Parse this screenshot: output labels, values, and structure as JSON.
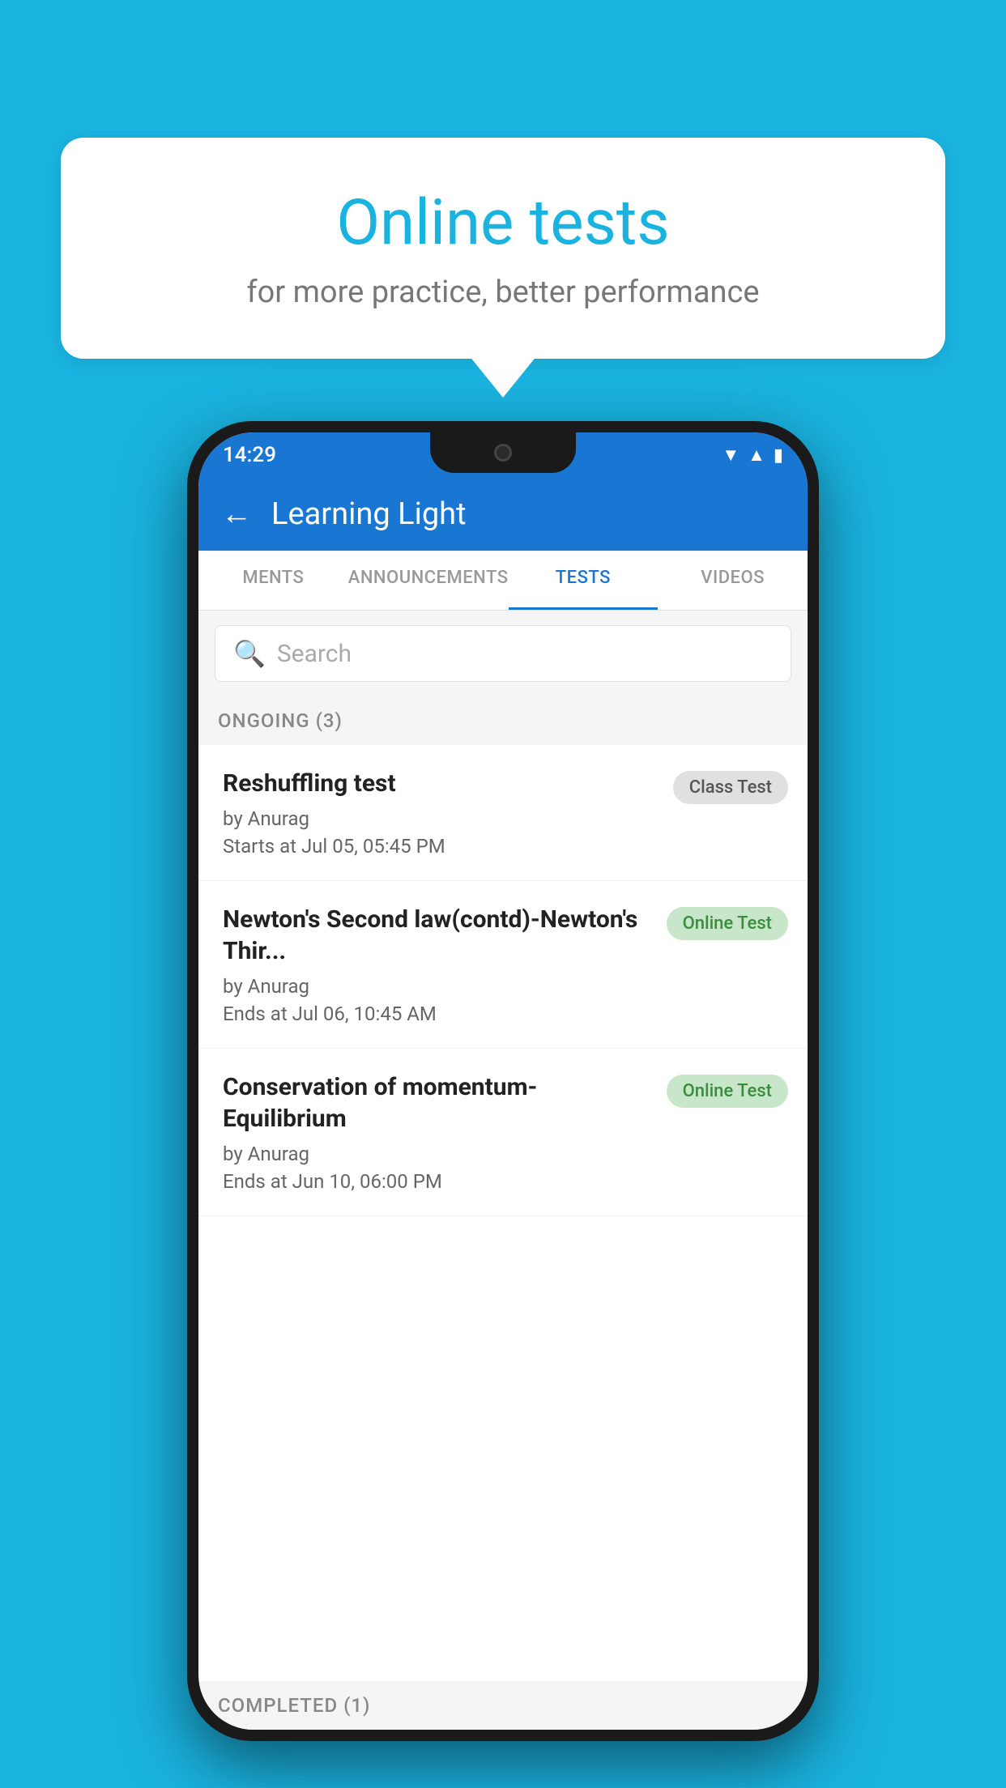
{
  "background": {
    "color": "#1ab3e0"
  },
  "speech_bubble": {
    "title": "Online tests",
    "subtitle": "for more practice, better performance"
  },
  "phone": {
    "status_bar": {
      "time": "14:29",
      "icons": [
        "wifi",
        "signal",
        "battery"
      ]
    },
    "app_header": {
      "back_label": "←",
      "title": "Learning Light"
    },
    "tabs": [
      {
        "label": "MENTS",
        "active": false
      },
      {
        "label": "ANNOUNCEMENTS",
        "active": false
      },
      {
        "label": "TESTS",
        "active": true
      },
      {
        "label": "VIDEOS",
        "active": false
      }
    ],
    "search": {
      "placeholder": "Search"
    },
    "sections": [
      {
        "title": "ONGOING (3)",
        "tests": [
          {
            "name": "Reshuffling test",
            "by": "by Anurag",
            "time_label": "Starts at",
            "time": "Jul 05, 05:45 PM",
            "badge": "Class Test",
            "badge_type": "class"
          },
          {
            "name": "Newton's Second law(contd)-Newton's Thir...",
            "by": "by Anurag",
            "time_label": "Ends at",
            "time": "Jul 06, 10:45 AM",
            "badge": "Online Test",
            "badge_type": "online"
          },
          {
            "name": "Conservation of momentum-Equilibrium",
            "by": "by Anurag",
            "time_label": "Ends at",
            "time": "Jun 10, 06:00 PM",
            "badge": "Online Test",
            "badge_type": "online"
          }
        ]
      },
      {
        "title": "COMPLETED (1)",
        "tests": []
      }
    ]
  }
}
